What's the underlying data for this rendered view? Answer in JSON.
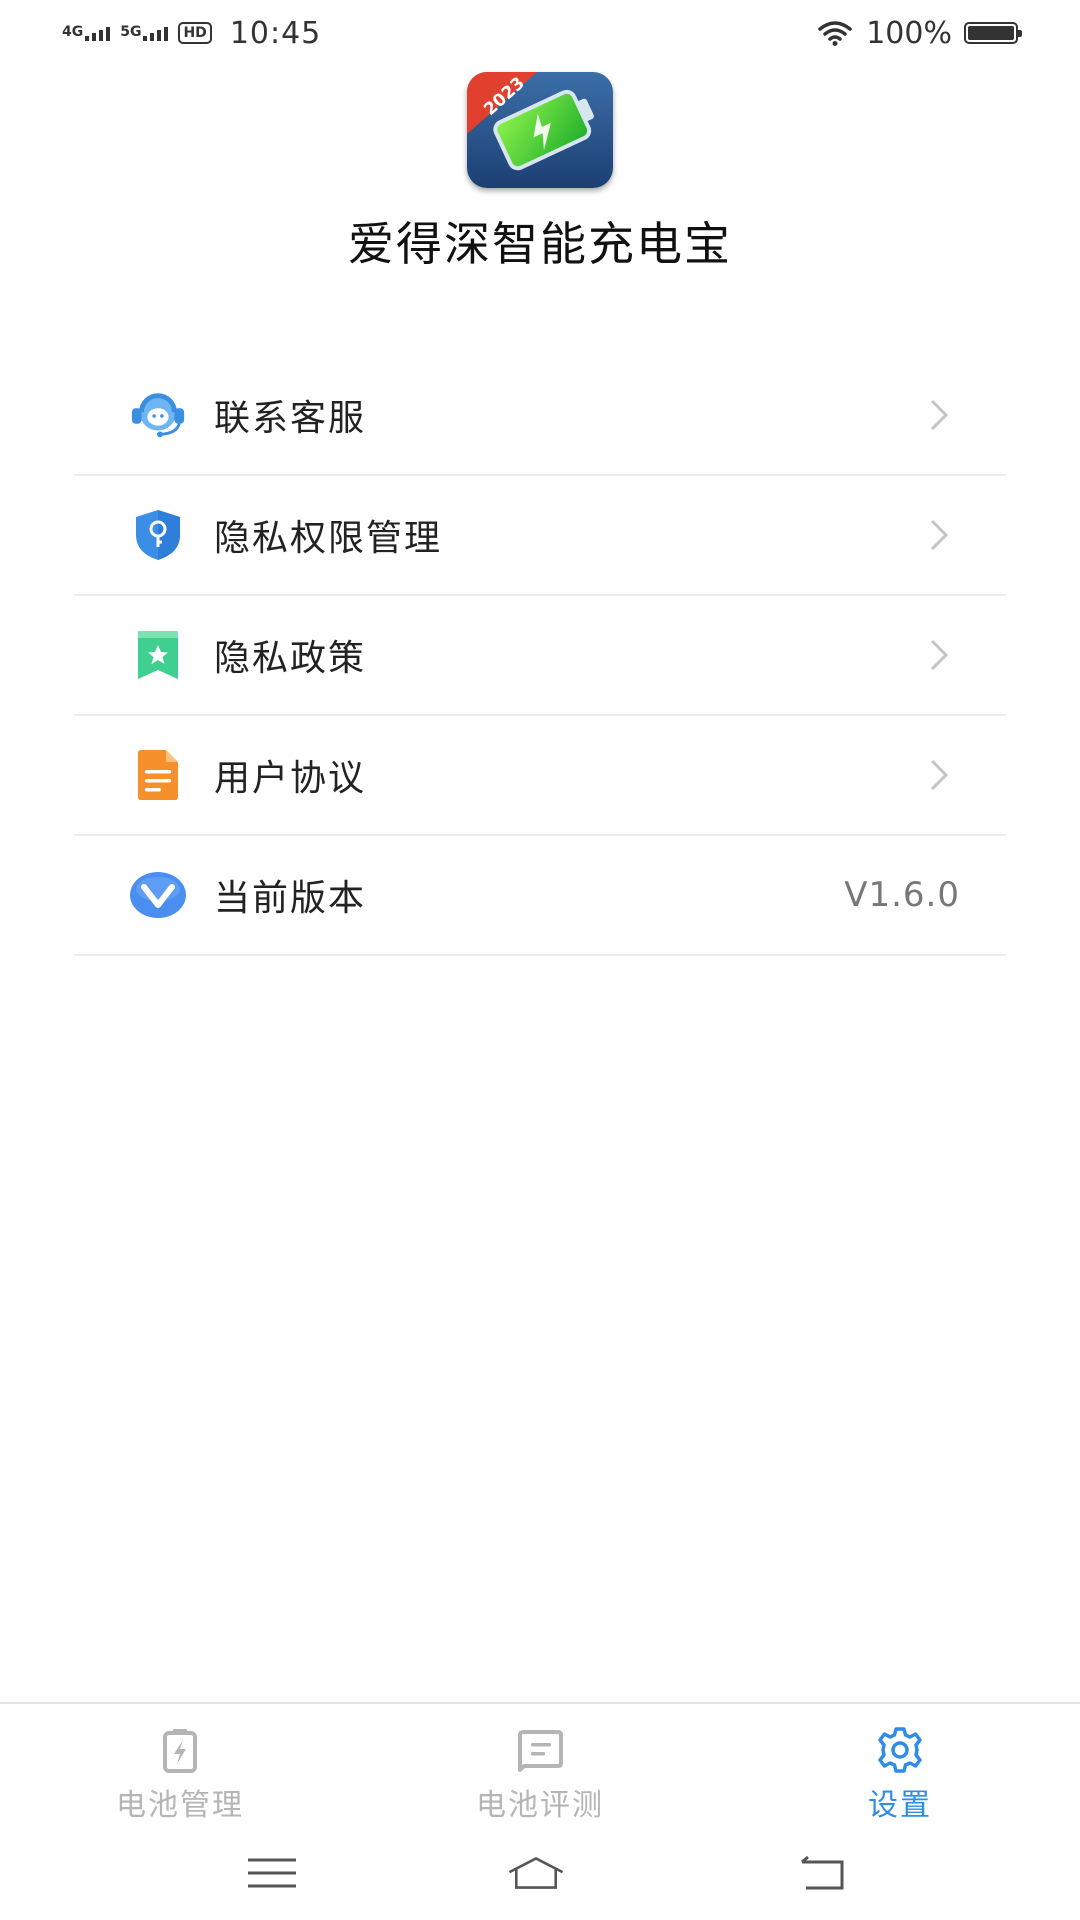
{
  "status_bar": {
    "net1": "4G",
    "net2": "5G",
    "hd": "HD",
    "time": "10:45",
    "battery": "100%"
  },
  "header": {
    "icon_name": "battery-charging-app-icon",
    "badge": "2023",
    "title": "爱得深智能充电宝"
  },
  "menu": [
    {
      "label": "联系客服",
      "icon": "customer-service-icon",
      "color": "#4a9bea"
    },
    {
      "label": "隐私权限管理",
      "icon": "shield-key-icon",
      "color": "#3b8ee6"
    },
    {
      "label": "隐私政策",
      "icon": "bookmark-star-icon",
      "color": "#3fcf8e"
    },
    {
      "label": "用户协议",
      "icon": "document-icon",
      "color": "#f5902b"
    },
    {
      "label": "当前版本",
      "icon": "version-v-icon",
      "color": "#4a8ff0",
      "value": "V1.6.0"
    }
  ],
  "tabs": [
    {
      "label": "电池管理",
      "icon": "battery-icon",
      "active": false
    },
    {
      "label": "电池评测",
      "icon": "chat-test-icon",
      "active": false
    },
    {
      "label": "设置",
      "icon": "gear-icon",
      "active": true
    }
  ],
  "colors": {
    "accent": "#2f8ce8",
    "inactive": "#b5b5b5"
  }
}
